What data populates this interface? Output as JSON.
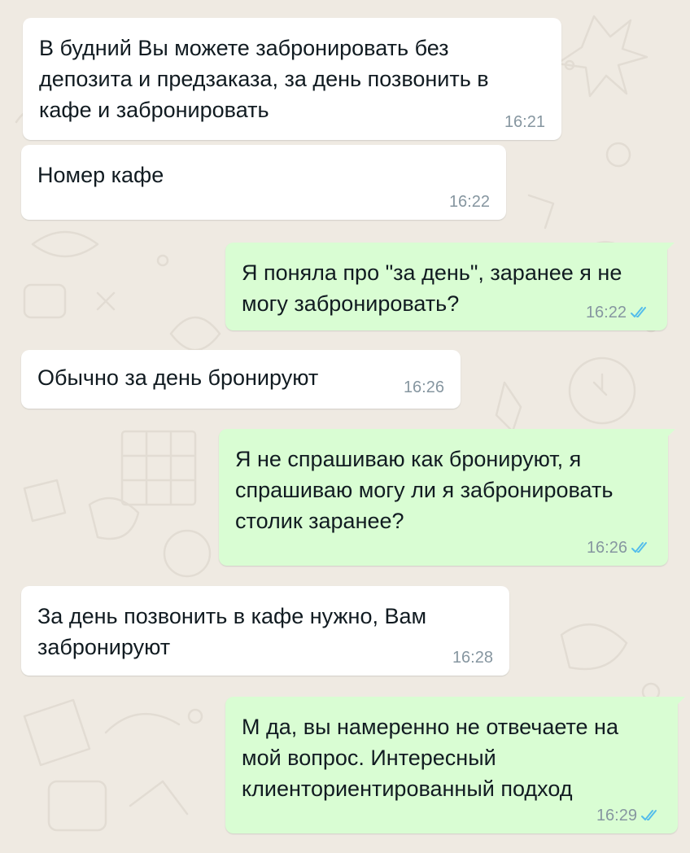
{
  "messages": [
    {
      "direction": "in",
      "text": "В будний Вы можете забронировать без депозита и предзаказа, за день позвонить в кафе и забронировать",
      "time": "16:21"
    },
    {
      "direction": "in",
      "text": "Номер кафе",
      "time": "16:22"
    },
    {
      "direction": "out",
      "text": "Я поняла про \"за день\", заранее я не могу забронировать?",
      "time": "16:22",
      "status": "read"
    },
    {
      "direction": "in",
      "text": "Обычно за день бронируют",
      "time": "16:26"
    },
    {
      "direction": "out",
      "text": "Я не спрашиваю как бронируют, я спрашиваю могу ли я забронировать столик заранее?",
      "time": "16:26",
      "status": "read"
    },
    {
      "direction": "in",
      "text": "За день позвонить в кафе нужно, Вам забронируют",
      "time": "16:28"
    },
    {
      "direction": "out",
      "text": "М да, вы намеренно не отвечаете на мой вопрос. Интересный клиенториентированный подход",
      "time": "16:29",
      "status": "read"
    }
  ],
  "colors": {
    "wallpaper": "#efeae2",
    "incoming_bubble": "#ffffff",
    "outgoing_bubble": "#d9fdd3",
    "text": "#111b21",
    "meta": "#8696a0",
    "read_ticks": "#53bdeb"
  },
  "icons": {
    "read_status": "double-check-icon"
  }
}
